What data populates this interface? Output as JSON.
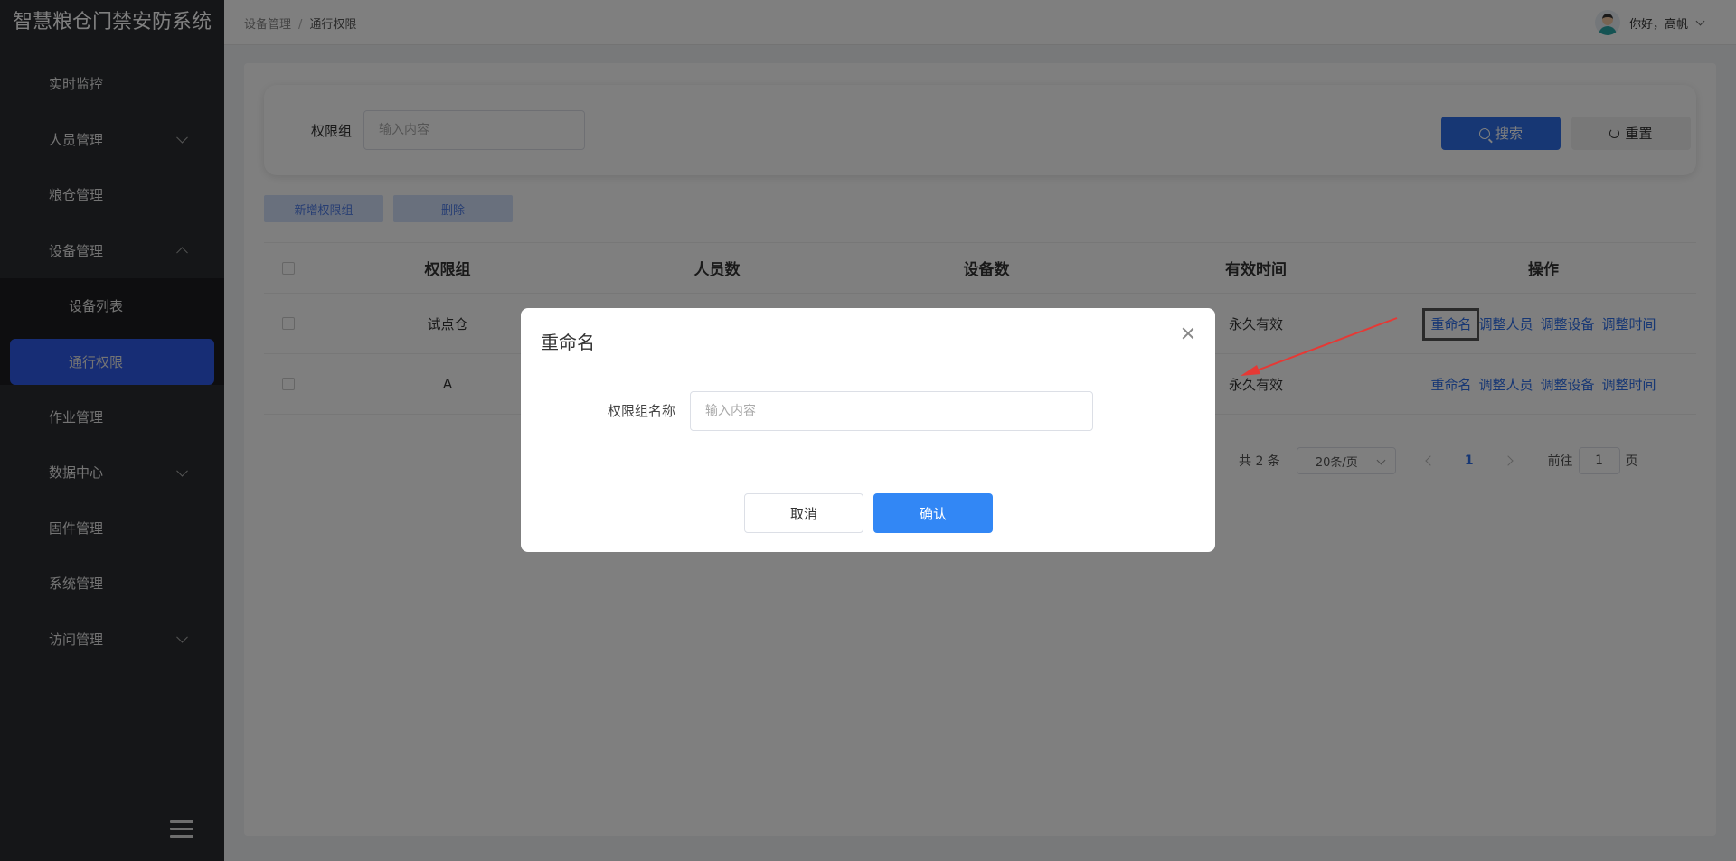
{
  "app": {
    "title": "智慧粮仓门禁安防系统"
  },
  "sidebar": {
    "items": [
      {
        "label": "实时监控"
      },
      {
        "label": "人员管理"
      },
      {
        "label": "粮仓管理"
      },
      {
        "label": "设备管理"
      },
      {
        "label": "设备列表"
      },
      {
        "label": "通行权限"
      },
      {
        "label": "作业管理"
      },
      {
        "label": "数据中心"
      },
      {
        "label": "固件管理"
      },
      {
        "label": "系统管理"
      },
      {
        "label": "访问管理"
      }
    ]
  },
  "header": {
    "breadcrumb": [
      "设备管理",
      "/",
      "通行权限"
    ],
    "user_greeting": "你好，高帆"
  },
  "search": {
    "label": "权限组",
    "placeholder": "输入内容",
    "search_button": "搜索",
    "reset_button": "重置"
  },
  "toolbar": {
    "add_label": "新增权限组",
    "delete_label": "删除"
  },
  "table": {
    "columns": [
      "权限组",
      "人员数",
      "设备数",
      "有效时间",
      "操作"
    ],
    "rows": [
      {
        "group": "试点仓",
        "people": "",
        "devices": "",
        "valid": "永久有效"
      },
      {
        "group": "A",
        "people": "",
        "devices": "",
        "valid": "永久有效"
      }
    ],
    "actions": [
      "重命名",
      "调整人员",
      "调整设备",
      "调整时间"
    ]
  },
  "pagination": {
    "total": "共 2 条",
    "page_size": "20条/页",
    "current": "1",
    "goto_prefix": "前往",
    "goto_value": "1",
    "goto_suffix": "页"
  },
  "dialog": {
    "title": "重命名",
    "field_label": "权限组名称",
    "placeholder": "输入内容",
    "cancel": "取消",
    "confirm": "确认"
  },
  "colors": {
    "primary": "#2f6fe8",
    "sidebar_bg": "#2b2d31",
    "active_menu": "#2f5bea",
    "annotation": "#e53935"
  }
}
